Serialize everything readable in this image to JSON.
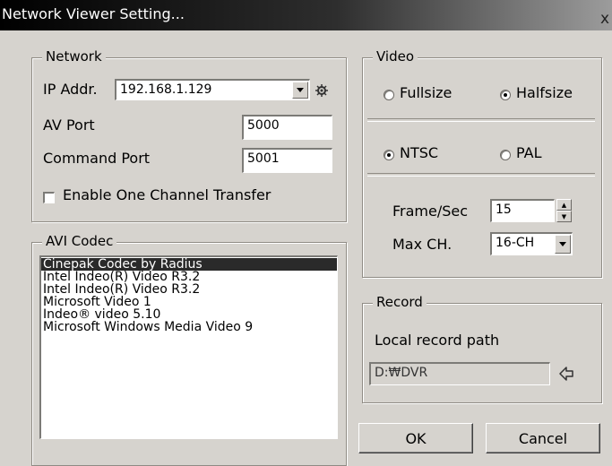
{
  "window": {
    "title": "Network Viewer Setting...",
    "close_glyph": "x"
  },
  "network": {
    "group_label": "Network",
    "ip_label": "IP Addr.",
    "ip_value": "192.168.1.129",
    "av_port_label": "AV Port",
    "av_port_value": "5000",
    "command_port_label": "Command Port",
    "command_port_value": "5001",
    "one_channel_label": "Enable One Channel Transfer",
    "one_channel_checked": false
  },
  "codec": {
    "group_label": "AVI Codec",
    "items": [
      "Cinepak Codec by Radius",
      "Intel Indeo(R) Video R3.2",
      "Intel Indeo(R) Video R3.2",
      "Microsoft Video 1",
      "Indeo® video 5.10",
      "Microsoft Windows Media Video 9"
    ],
    "selected_index": 0
  },
  "video": {
    "group_label": "Video",
    "size_options": [
      "Fullsize",
      "Halfsize"
    ],
    "size_selected": "Halfsize",
    "standard_options": [
      "NTSC",
      "PAL"
    ],
    "standard_selected": "NTSC",
    "fps_label": "Frame/Sec",
    "fps_value": "15",
    "maxch_label": "Max CH.",
    "maxch_value": "16-CH"
  },
  "record": {
    "group_label": "Record",
    "path_label": "Local record path",
    "path_value": "D:₩DVR"
  },
  "buttons": {
    "ok_label": "OK",
    "cancel_label": "Cancel"
  },
  "icons": {
    "ip_extra": "gear-icon",
    "browse": "browse-folder-icon"
  }
}
